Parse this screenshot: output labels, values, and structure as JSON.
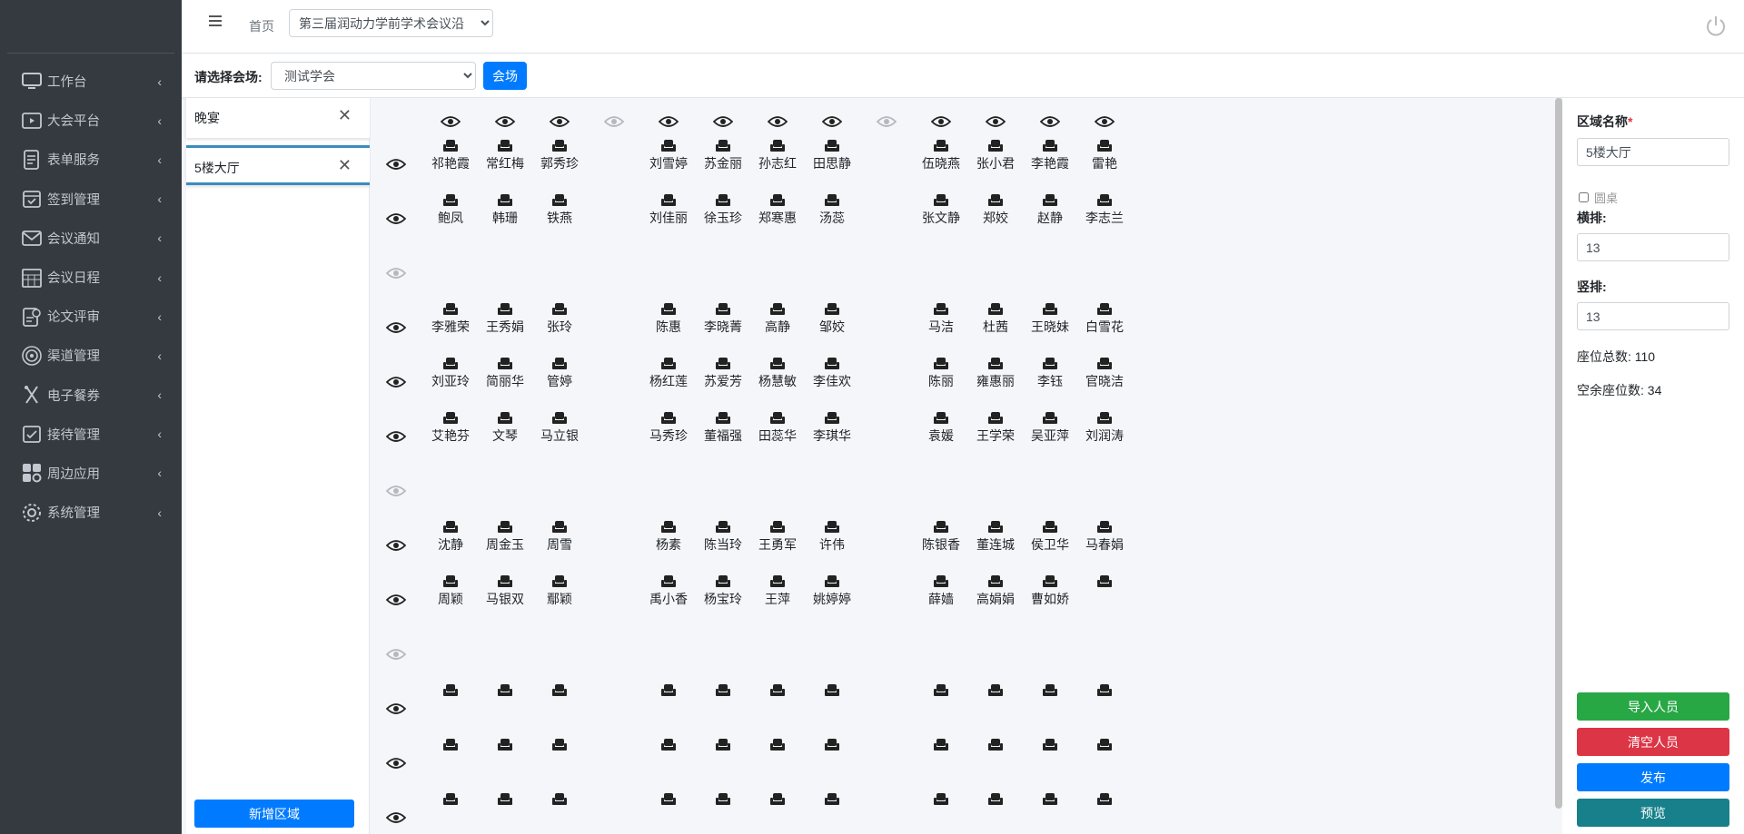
{
  "sidebar": {
    "items": [
      {
        "label": "工作台",
        "icon": "desktop-icon"
      },
      {
        "label": "大会平台",
        "icon": "play-window-icon"
      },
      {
        "label": "表单服务",
        "icon": "form-icon"
      },
      {
        "label": "签到管理",
        "icon": "calendar-check-icon"
      },
      {
        "label": "会议通知",
        "icon": "envelope-icon"
      },
      {
        "label": "会议日程",
        "icon": "calendar-grid-icon"
      },
      {
        "label": "论文评审",
        "icon": "paper-review-icon"
      },
      {
        "label": "渠道管理",
        "icon": "target-icon"
      },
      {
        "label": "电子餐券",
        "icon": "utensils-icon"
      },
      {
        "label": "接待管理",
        "icon": "reception-icon"
      },
      {
        "label": "周边应用",
        "icon": "apps-icon"
      },
      {
        "label": "系统管理",
        "icon": "gear-icon"
      }
    ]
  },
  "navbar": {
    "home": "首页",
    "conference": "第三届润动力学前学术会议沿"
  },
  "venue": {
    "label": "请选择会场:",
    "selected": "测试学会",
    "button": "会场"
  },
  "regions": {
    "items": [
      "晚宴",
      "5楼大厅"
    ],
    "active": "5楼大厅",
    "add_button": "新增区域"
  },
  "grid": {
    "column_eye_disabled": [
      3,
      8
    ],
    "row_eye_disabled": [
      2,
      6,
      9
    ],
    "rows": [
      [
        "祁艳霞",
        "常红梅",
        "郭秀珍",
        null,
        "刘雪婷",
        "苏金丽",
        "孙志红",
        "田思静",
        null,
        "伍晓燕",
        "张小君",
        "李艳霞",
        "雷艳"
      ],
      [
        "鲍凤",
        "韩珊",
        "铁燕",
        null,
        "刘佳丽",
        "徐玉珍",
        "郑寒惠",
        "汤蕊",
        null,
        "张文静",
        "郑姣",
        "赵静",
        "李志兰"
      ],
      null,
      [
        "李雅荣",
        "王秀娟",
        "张玲",
        null,
        "陈惠",
        "李晓菁",
        "高静",
        "邹姣",
        null,
        "马洁",
        "杜茜",
        "王晓妹",
        "白雪花"
      ],
      [
        "刘亚玲",
        "简丽华",
        "管婷",
        null,
        "杨红莲",
        "苏爱芳",
        "杨慧敏",
        "李佳欢",
        null,
        "陈丽",
        "雍惠丽",
        "李钰",
        "官晓洁"
      ],
      [
        "艾艳芬",
        "文琴",
        "马立银",
        null,
        "马秀珍",
        "董福强",
        "田蕊华",
        "李琪华",
        null,
        "袁媛",
        "王学荣",
        "吴亚萍",
        "刘润涛"
      ],
      null,
      [
        "沈静",
        "周金玉",
        "周雪",
        null,
        "杨素",
        "陈当玲",
        "王勇军",
        "许伟",
        null,
        "陈银香",
        "董连城",
        "侯卫华",
        "马春娟"
      ],
      [
        "周颖",
        "马银双",
        "鄢颖",
        null,
        "禹小香",
        "杨宝玲",
        "王萍",
        "姚婷婷",
        null,
        "薛嫱",
        "高娟娟",
        "曹如娇",
        ""
      ],
      null,
      [
        "",
        "",
        "",
        null,
        "",
        "",
        "",
        "",
        null,
        "",
        "",
        "",
        ""
      ],
      [
        "",
        "",
        "",
        null,
        "",
        "",
        "",
        "",
        null,
        "",
        "",
        "",
        ""
      ],
      [
        "",
        "",
        "",
        null,
        "",
        "",
        "",
        "",
        null,
        "",
        "",
        "",
        ""
      ]
    ]
  },
  "panel": {
    "region_name_label": "区域名称",
    "region_name_required": "*",
    "region_name": "5楼大厅",
    "round_table": "圆桌",
    "rows_label": "横排:",
    "rows": "13",
    "cols_label": "竖排:",
    "cols": "13",
    "total_seats": "座位总数: 110",
    "empty_seats": "空余座位数: 34",
    "buttons": [
      {
        "label": "导入人员",
        "color": "#28a745"
      },
      {
        "label": "清空人员",
        "color": "#dc3545"
      },
      {
        "label": "发布",
        "color": "#007bff"
      },
      {
        "label": "预览",
        "color": "#17808a"
      }
    ]
  }
}
